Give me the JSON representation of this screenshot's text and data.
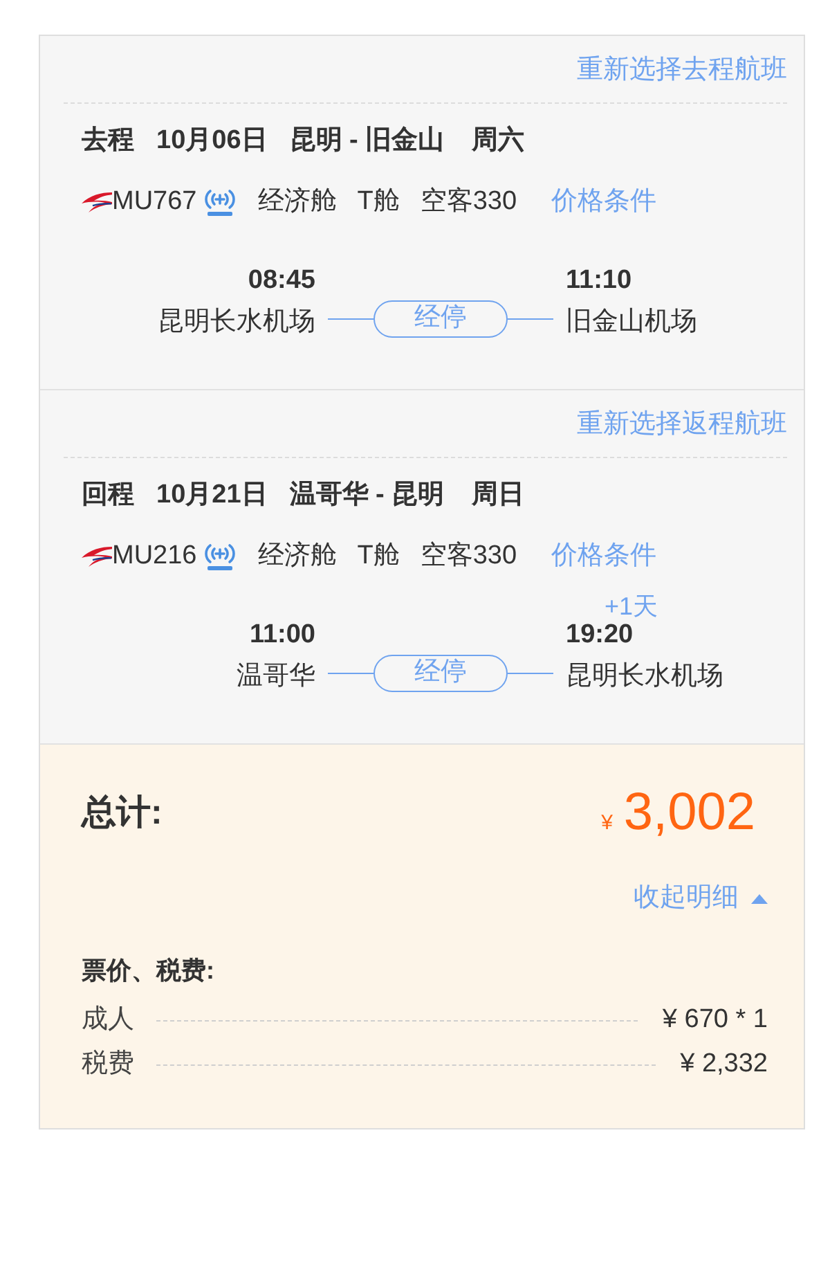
{
  "segments": [
    {
      "reselect_link": "重新选择去程航班",
      "direction": "去程",
      "date": "10月06日",
      "route": "昆明 - 旧金山",
      "weekday": "周六",
      "flight_no": "MU767",
      "cabin": "经济舱",
      "cabin_class": "T舱",
      "aircraft": "空客330",
      "price_rules_link": "价格条件",
      "departure": {
        "time": "08:45",
        "airport": "昆明长水机场"
      },
      "stop_label": "经停",
      "arrival": {
        "time": "11:10",
        "airport": "旧金山机场"
      }
    },
    {
      "reselect_link": "重新选择返程航班",
      "direction": "回程",
      "date": "10月21日",
      "route": "温哥华 - 昆明",
      "weekday": "周日",
      "flight_no": "MU216",
      "cabin": "经济舱",
      "cabin_class": "T舱",
      "aircraft": "空客330",
      "price_rules_link": "价格条件",
      "departure": {
        "time": "11:00",
        "airport": "温哥华"
      },
      "stop_label": "经停",
      "arrival": {
        "day_offset": "+1天",
        "time": "19:20",
        "airport": "昆明长水机场"
      }
    }
  ],
  "summary": {
    "total_label": "总计:",
    "currency": "¥",
    "total": "3,002",
    "toggle_link": "收起明细",
    "expanded": true,
    "breakdown_title": "票价、税费:",
    "items": [
      {
        "label": "成人",
        "value": "¥ 670 * 1"
      },
      {
        "label": "税费",
        "value": "¥ 2,332"
      }
    ]
  }
}
